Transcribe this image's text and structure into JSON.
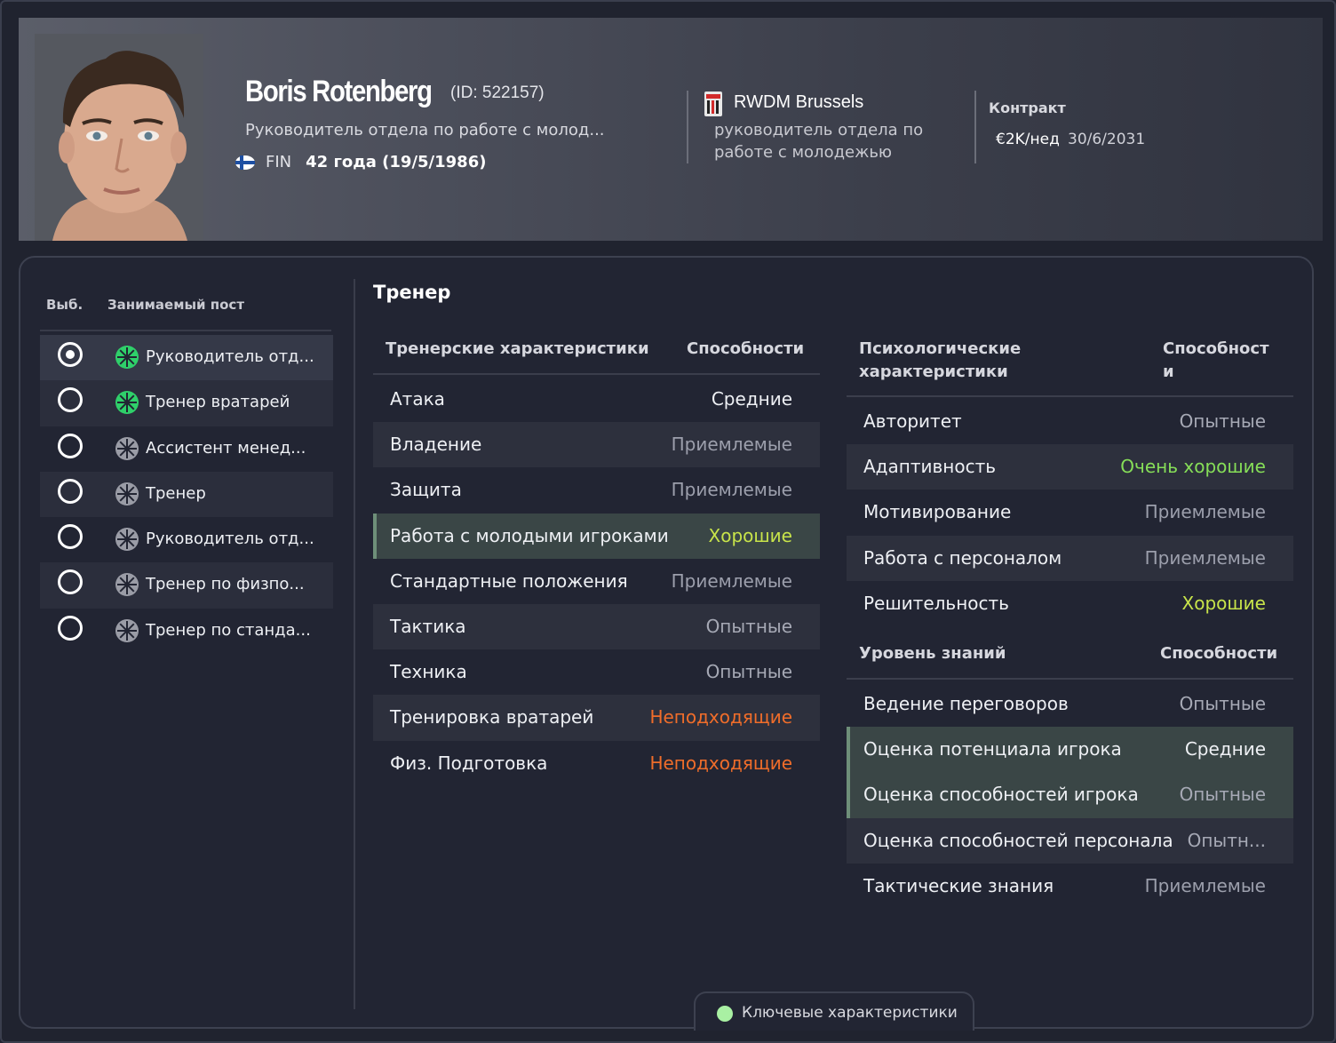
{
  "staff": {
    "name": "Boris Rotenberg",
    "id_label": "(ID: 522157)",
    "role": "Руководитель отдела по работе с молод...",
    "nationality_code": "FIN",
    "age_label": "42 года (19/5/1986)"
  },
  "club": {
    "name": "RWDM Brussels",
    "role": "руководитель отдела по работе с молодежью"
  },
  "contract": {
    "label": "Контракт",
    "wage": "€2K/нед",
    "expiry": "30/6/2031"
  },
  "positions": {
    "col_select": "Выб.",
    "col_post": "Занимаемый пост",
    "items": [
      {
        "label": "Руководитель отд...",
        "selected": true,
        "active": true
      },
      {
        "label": "Тренер вратарей",
        "selected": false,
        "active": true
      },
      {
        "label": "Ассистент менед...",
        "selected": false,
        "active": false
      },
      {
        "label": "Тренер",
        "selected": false,
        "active": false
      },
      {
        "label": "Руководитель отд...",
        "selected": false,
        "active": false
      },
      {
        "label": "Тренер по физпо...",
        "selected": false,
        "active": false
      },
      {
        "label": "Тренер по станда...",
        "selected": false,
        "active": false
      }
    ]
  },
  "section_title": "Тренер",
  "coaching": {
    "header_name": "Тренерские характеристики",
    "header_value": "Способности",
    "rows": [
      {
        "name": "Атака",
        "value": "Средние",
        "tone": "mid",
        "key": false
      },
      {
        "name": "Владение",
        "value": "Приемлемые",
        "tone": "ok",
        "key": false
      },
      {
        "name": "Защита",
        "value": "Приемлемые",
        "tone": "ok",
        "key": false
      },
      {
        "name": "Работа с молодыми игроками",
        "value": "Хорошие",
        "tone": "good",
        "key": true
      },
      {
        "name": "Стандартные положения",
        "value": "Приемлемые",
        "tone": "ok",
        "key": false
      },
      {
        "name": "Тактика",
        "value": "Опытные",
        "tone": "exp",
        "key": false
      },
      {
        "name": "Техника",
        "value": "Опытные",
        "tone": "exp",
        "key": false
      },
      {
        "name": "Тренировка вратарей",
        "value": "Неподходящие",
        "tone": "bad",
        "key": false
      },
      {
        "name": "Физ. Подготовка",
        "value": "Неподходящие",
        "tone": "bad",
        "key": false
      }
    ]
  },
  "mental": {
    "header_name_1": "Психологические",
    "header_name_2": "характеристики",
    "header_value_1": "Способност",
    "header_value_2": "и",
    "rows": [
      {
        "name": "Авторитет",
        "value": "Опытные",
        "tone": "exp",
        "key": false
      },
      {
        "name": "Адаптивность",
        "value": "Очень хорошие",
        "tone": "vgood",
        "key": false
      },
      {
        "name": "Мотивирование",
        "value": "Приемлемые",
        "tone": "ok",
        "key": false
      },
      {
        "name": "Работа с персоналом",
        "value": "Приемлемые",
        "tone": "ok",
        "key": false
      },
      {
        "name": "Решительность",
        "value": "Хорошие",
        "tone": "good",
        "key": false
      }
    ]
  },
  "knowledge": {
    "header_name": "Уровень знаний",
    "header_value": "Способности",
    "rows": [
      {
        "name": "Ведение переговоров",
        "value": "Опытные",
        "tone": "exp",
        "key": false
      },
      {
        "name": "Оценка потенциала игрока",
        "value": "Средние",
        "tone": "mid",
        "key": true
      },
      {
        "name": "Оценка способностей игрока",
        "value": "Опытные",
        "tone": "exp",
        "key": true
      },
      {
        "name": "Оценка способностей персонала",
        "value": "Опытн...",
        "tone": "exp",
        "key": false
      },
      {
        "name": "Тактические знания",
        "value": "Приемлемые",
        "tone": "ok",
        "key": false
      }
    ]
  },
  "key_attributes_label": "Ключевые характеристики",
  "colors": {
    "good": "#c8e44a",
    "very_good": "#86de58",
    "unsuitable": "#f06d2a",
    "key_highlight": "#3a4646",
    "key_dot": "#a9f0a3"
  },
  "icons": {
    "flag": "finland-flag-icon",
    "club": "club-crest-icon",
    "position": "position-wheel-icon",
    "radio": "radio-button-icon"
  }
}
